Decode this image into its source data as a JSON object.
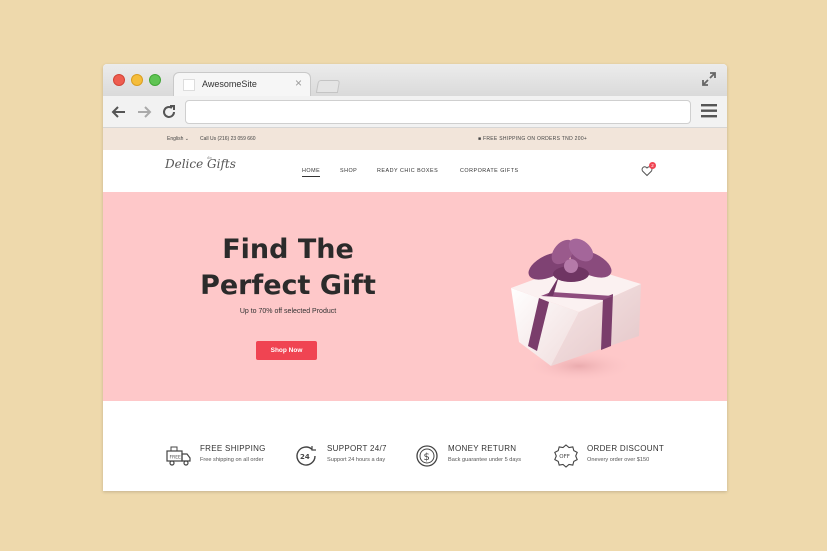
{
  "browser": {
    "tab_title": "AwesomeSite"
  },
  "topbar": {
    "language": "English ⌄",
    "phone": "Call Us (216) 23 059 660",
    "shipping_notice": "FREE SHIPPING ON ORDERS TND 200+"
  },
  "header": {
    "logo_text": "Delice Gifts",
    "logo_small": "de",
    "nav": [
      {
        "label": "HOME"
      },
      {
        "label": "SHOP"
      },
      {
        "label": "READY CHIC BOXES"
      },
      {
        "label": "CORPORATE GIFTS"
      }
    ],
    "badge_count": "2"
  },
  "hero": {
    "title_line1": "Find The",
    "title_line2": "Perfect Gift",
    "subtitle": "Up to 70% off selected Product",
    "button": "Shop Now"
  },
  "features": [
    {
      "icon": "truck-icon",
      "title": "FREE SHIPPING",
      "desc": "Free shipping on all order"
    },
    {
      "icon": "clock-24-icon",
      "title": "SUPPORT 24/7",
      "desc": "Support 24 hours a day"
    },
    {
      "icon": "dollar-icon",
      "title": "MONEY RETURN",
      "desc": "Back guarantee under 5 days"
    },
    {
      "icon": "discount-badge-icon",
      "title": "ORDER DISCOUNT",
      "desc": "Onevery order over $150"
    }
  ],
  "colors": {
    "background": "#eed9ac",
    "hero_bg": "#fec8c9",
    "accent": "#f04452",
    "infobar_bg": "#f2e5da",
    "gift_ribbon": "#7a3d6b"
  }
}
